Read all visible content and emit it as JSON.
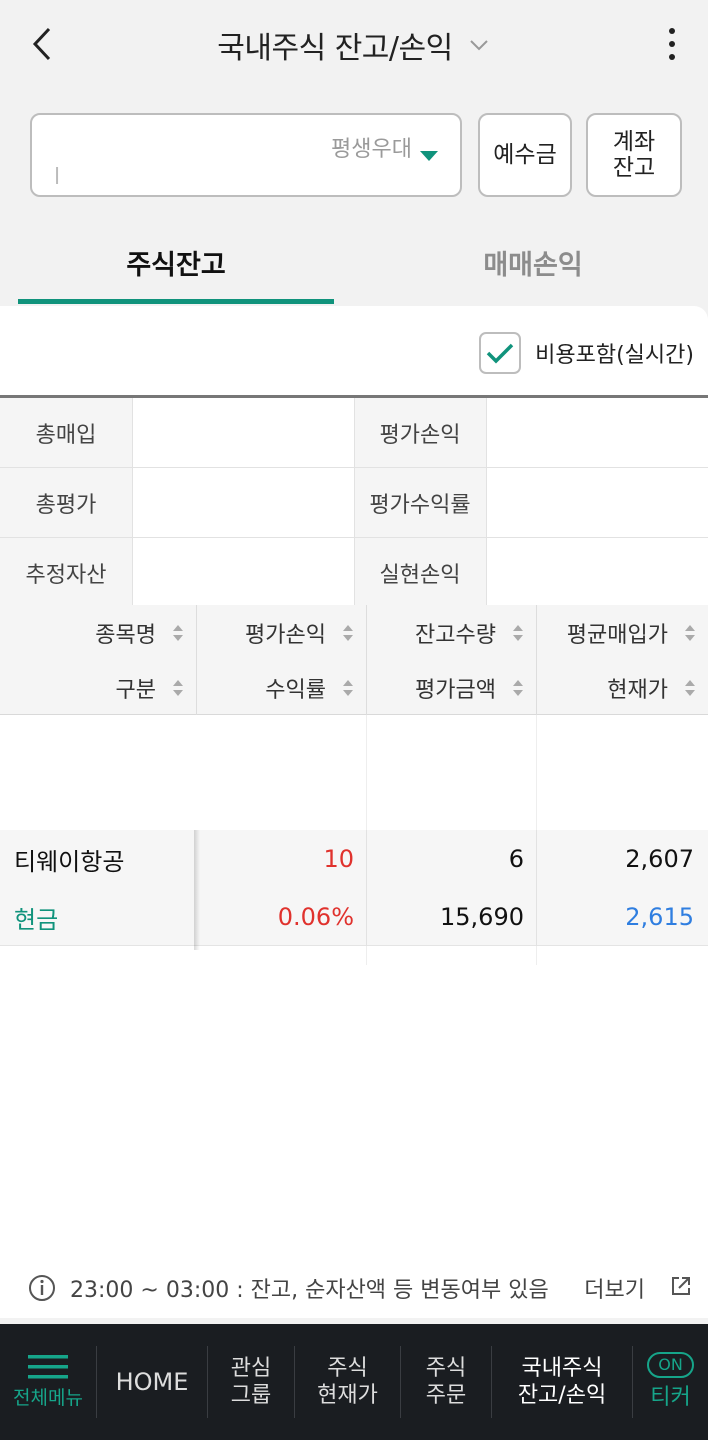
{
  "header": {
    "title": "국내주식 잔고/손익"
  },
  "account": {
    "type": "평생우대",
    "number": "l"
  },
  "buttons": {
    "deposit": "예수금",
    "account_balance_line1": "계좌",
    "account_balance_line2": "잔고"
  },
  "tabs": {
    "stock_balance": "주식잔고",
    "trade_pnl": "매매손익"
  },
  "options": {
    "include_cost_label": "비용포함(실시간)",
    "include_cost_checked": true
  },
  "summary": {
    "labels": {
      "total_buy": "총매입",
      "total_eval": "총평가",
      "estimated_assets": "추정자산",
      "eval_pnl": "평가손익",
      "eval_return": "평가수익률",
      "realized_pnl": "실현손익"
    }
  },
  "grid": {
    "headers_row1": [
      "종목명",
      "평가손익",
      "잔고수량",
      "평균매입가"
    ],
    "headers_row2": [
      "구분",
      "수익률",
      "평가금액",
      "현재가"
    ],
    "rows": [
      {
        "name": "티웨이항공",
        "type": "현금",
        "eval_pnl": "10",
        "return_rate": "0.06%",
        "quantity": "6",
        "eval_amount": "15,690",
        "avg_price": "2,607",
        "current_price": "2,615"
      }
    ]
  },
  "colors": {
    "accent": "#10937c",
    "profit": "#e0322d",
    "price_down": "#2f7ee0",
    "nav_bg": "#1a1d21"
  },
  "notice": {
    "text": "23:00 ~ 03:00 : 잔고, 순자산액 등 변동여부 있음",
    "more": "더보기"
  },
  "bottom_nav": {
    "menu": "전체메뉴",
    "home": "HOME",
    "watch_1": "관심",
    "watch_2": "그룹",
    "price_1": "주식",
    "price_2": "현재가",
    "order_1": "주식",
    "order_2": "주문",
    "balance_1": "국내주식",
    "balance_2": "잔고/손익",
    "ticker_badge": "ON",
    "ticker": "티커"
  }
}
